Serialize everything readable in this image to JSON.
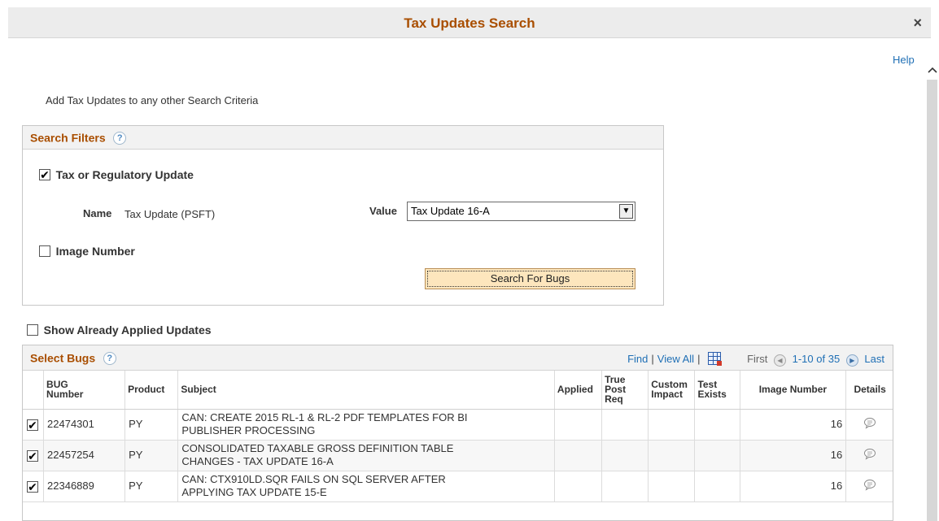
{
  "window": {
    "title": "Tax Updates Search",
    "close_label": "×",
    "help_label": "Help"
  },
  "intro_text": "Add Tax Updates to any other Search Criteria",
  "search_filters": {
    "title": "Search Filters",
    "help_icon": "?",
    "tax_update_checkbox": {
      "label": "Tax or Regulatory Update",
      "checked": true
    },
    "name_label": "Name",
    "name_value": "Tax Update (PSFT)",
    "value_label": "Value",
    "value_selected": "Tax Update 16-A",
    "image_number_checkbox": {
      "label": "Image Number",
      "checked": false
    },
    "search_button": "Search For Bugs"
  },
  "show_applied": {
    "label": "Show Already Applied Updates",
    "checked": false
  },
  "grid": {
    "title": "Select Bugs",
    "help_icon": "?",
    "find": "Find",
    "view_all": "View All",
    "sep": "|",
    "first": "First",
    "range": "1-10 of 35",
    "last": "Last",
    "headers": {
      "bug_number_1": "BUG",
      "bug_number_2": "Number",
      "product": "Product",
      "subject": "Subject",
      "applied": "Applied",
      "true_post_1": "True",
      "true_post_2": "Post",
      "true_post_3": "Req",
      "custom_1": "Custom",
      "custom_2": "Impact",
      "test_1": "Test",
      "test_2": "Exists",
      "image_number": "Image Number",
      "details": "Details"
    },
    "rows": [
      {
        "checked": true,
        "bug": "22474301",
        "product": "PY",
        "subject_1": "CAN: CREATE 2015 RL-1 & RL-2 PDF TEMPLATES FOR BI",
        "subject_2": "PUBLISHER PROCESSING",
        "image": "16"
      },
      {
        "checked": true,
        "bug": "22457254",
        "product": "PY",
        "subject_1": "CONSOLIDATED TAXABLE GROSS DEFINITION TABLE",
        "subject_2": "CHANGES - TAX UPDATE 16-A",
        "image": "16"
      },
      {
        "checked": true,
        "bug": "22346889",
        "product": "PY",
        "subject_1": "CAN: CTX910LD.SQR FAILS ON SQL SERVER AFTER",
        "subject_2": "APPLYING TAX UPDATE 15-E",
        "image": "16"
      }
    ]
  },
  "colors": {
    "title": "#a94e00",
    "link": "#1f6fb5",
    "button_bg": "#fde6bd"
  },
  "icons": [
    "close-icon",
    "help-icon",
    "chevron-up-icon",
    "dropdown-arrow-icon",
    "excel-download-icon",
    "previous-arrow-icon",
    "next-arrow-icon",
    "details-chat-icon"
  ]
}
